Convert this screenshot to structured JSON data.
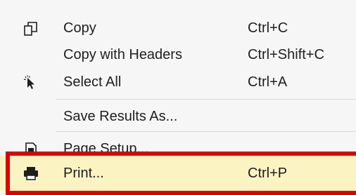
{
  "menu": {
    "items": [
      {
        "label": "Copy",
        "shortcut": "Ctrl+C",
        "icon": "copy-icon"
      },
      {
        "label": "Copy with Headers",
        "shortcut": "Ctrl+Shift+C",
        "icon": ""
      },
      {
        "label": "Select All",
        "shortcut": "Ctrl+A",
        "icon": "select-all-icon"
      },
      {
        "label": "Save Results As...",
        "shortcut": "",
        "icon": ""
      },
      {
        "label": "Page Setup...",
        "shortcut": "",
        "icon": "page-setup-icon"
      },
      {
        "label": "Print...",
        "shortcut": "Ctrl+P",
        "icon": "printer-icon"
      }
    ],
    "highlighted_item": "Print...",
    "colors": {
      "highlight_background": "#fcf3c3",
      "annotation_border": "#e00000",
      "menu_background": "#f6f6f6"
    }
  }
}
